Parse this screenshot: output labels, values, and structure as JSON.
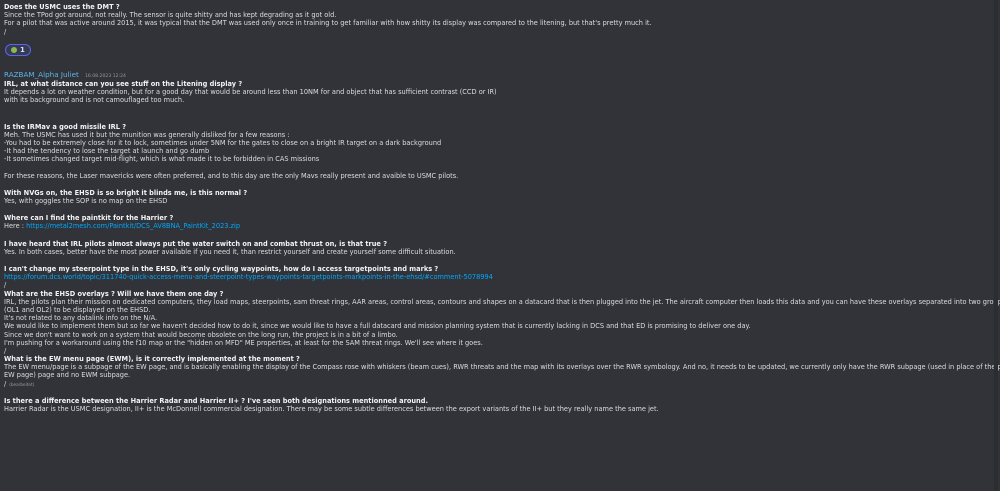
{
  "msg1": {
    "question": "Does the USMC uses the DMT ?",
    "lines": [
      "Since the TPod got around, not really. The sensor is quite shitty and has kept degrading as it got old.",
      "For a pilot that was active around 2015, it was typical that the DMT was used only once in training to get familiar with how shitty its display was compared to the litening, but that's pretty much it.",
      "/"
    ],
    "reaction": {
      "count": "1",
      "emoji": "thumbs-up-icon"
    }
  },
  "author": {
    "name": "RAZBAM_Alpha Juliet",
    "timestamp": "16.08.2023 12:24"
  },
  "edited_label": "(bearbeitet)",
  "qa": [
    {
      "q": "IRL, at what distance can you see stuff on the Litening display ?",
      "a": [
        "It depends a lot on weather condition, but for a good day that would be around less than 10NM for and object that has sufficient contrast (CCD or IR)",
        "with its background and is not camouflaged too much."
      ]
    },
    {
      "q": "Is the IRMav a good missile IRL ?",
      "a": [
        "Meh. The USMC has used it but the munition was generally disliked for a few reasons :",
        "-You had to be extremely close for it to lock, sometimes under 5NM for the gates to close on a bright IR target on a dark background",
        "-It had the tendency to lose the target at launch and go dumb",
        "-It sometimes changed target mid-flight, which is what made it to be forbidden in CAS missions",
        "",
        "For these reasons, the Laser mavericks were often preferred, and to this day are the only Mavs really present and avaible to USMC pilots."
      ]
    },
    {
      "q": "With NVGs on, the EHSD is so bright it blinds me, is this normal ?",
      "a": [
        "Yes, with goggles the SOP is no map on the EHSD"
      ]
    },
    {
      "q": "Where can I find the paintkit for the Harrier ?",
      "a_prefix": "Here : ",
      "link": "https://metal2mesh.com/Paintkit/DCS_AV8BNA_PaintKit_2023.zip"
    },
    {
      "q": "I have heard that IRL pilots almost always put the water switch on and combat thrust on, is that true ?",
      "a": [
        "Yes. In both cases, better have the most power available if you need it, than restrict yourself and create yourself some difficult situation."
      ]
    },
    {
      "q": "I can't change my steerpoint type in the EHSD, it's only cycling waypoints, how do I access targetpoints and marks ?",
      "link": "https://forum.dcs.world/topic/311740-quick-access-menu-and-steerpoint-types-waypoints-targetpoints-markpoints-in-the-ehsd/#comment-5078994",
      "after": "/"
    },
    {
      "q": "What are the EHSD overlays ? Will we have them one day ?",
      "a": [
        "IRL, the pilots plan their mission on dedicated computers, they load maps, steerpoints, sam threat rings, AAR areas, control areas, contours and shapes on a datacard that is then  plugged into the jet. The aircraft computer then loads this data and you can have these overlays separated into two groups",
        "(OL1 and OL2) to be displayed on the EHSD.",
        "It's not related to any datalink info on the N/A.",
        "We would like to implement them but so far we haven't decided how to do it, since we would like to have a full datacard and mission planning system that is currently lacking in DCS and that ED is promising to deliver one day.",
        "Since we don't want to work on a system that would become obsolete on the long run, the project is in a bit of a limbo.",
        "I'm pushing for a workaround using the f10 map or the \"hidden on MFD\" ME properties, at least for the SAM threat rings. We'll see where it goes.",
        "/"
      ]
    },
    {
      "q": "What is the EW menu page (EWM), is it correctly implemented at the moment ?",
      "a": [
        "The EW menu/page is a subpage of the EW page, and is basically enabling the display of the Compass rose with whiskers (beam cues), RWR threats and the map with its overlays over the RWR symbology. And no, it needs to be updated, we currently only have the RWR subpage (used in place of the proper",
        "EW page) page and no EWM subpage."
      ],
      "after_edited": "/"
    },
    {
      "q": "Is there a difference between the Harrier Radar and Harrier II+ ?  I've seen both designations mentionned around.",
      "a": [
        "Harrier Radar is the USMC designation, II+ is the McDonnell commercial designation. There may be some subtle differences between the export variants of the II+ but they really name the same jet."
      ]
    }
  ]
}
